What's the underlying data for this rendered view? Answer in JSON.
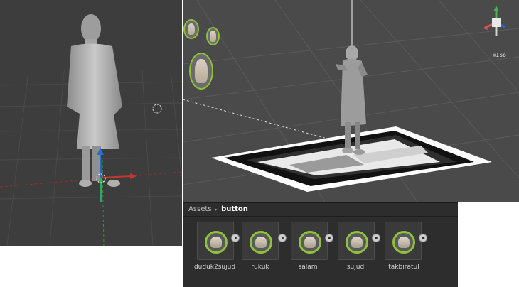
{
  "scene": {
    "gizmo_label": "≡Iso"
  },
  "assets_panel": {
    "breadcrumb": [
      "Assets",
      "button"
    ],
    "items": [
      {
        "label": "duduk2sujud",
        "icon": "character-prefab-icon"
      },
      {
        "label": "rukuk",
        "icon": "character-prefab-icon"
      },
      {
        "label": "salam",
        "icon": "character-prefab-icon"
      },
      {
        "label": "sujud",
        "icon": "character-prefab-icon"
      },
      {
        "label": "takbiratul",
        "icon": "character-prefab-icon"
      }
    ]
  },
  "colors": {
    "thumb_ring": "#8fc23a",
    "viewport_bg": "#3d3d3d",
    "scene_bg": "#4a4a4a",
    "panel_bg": "#2d2d2d"
  }
}
